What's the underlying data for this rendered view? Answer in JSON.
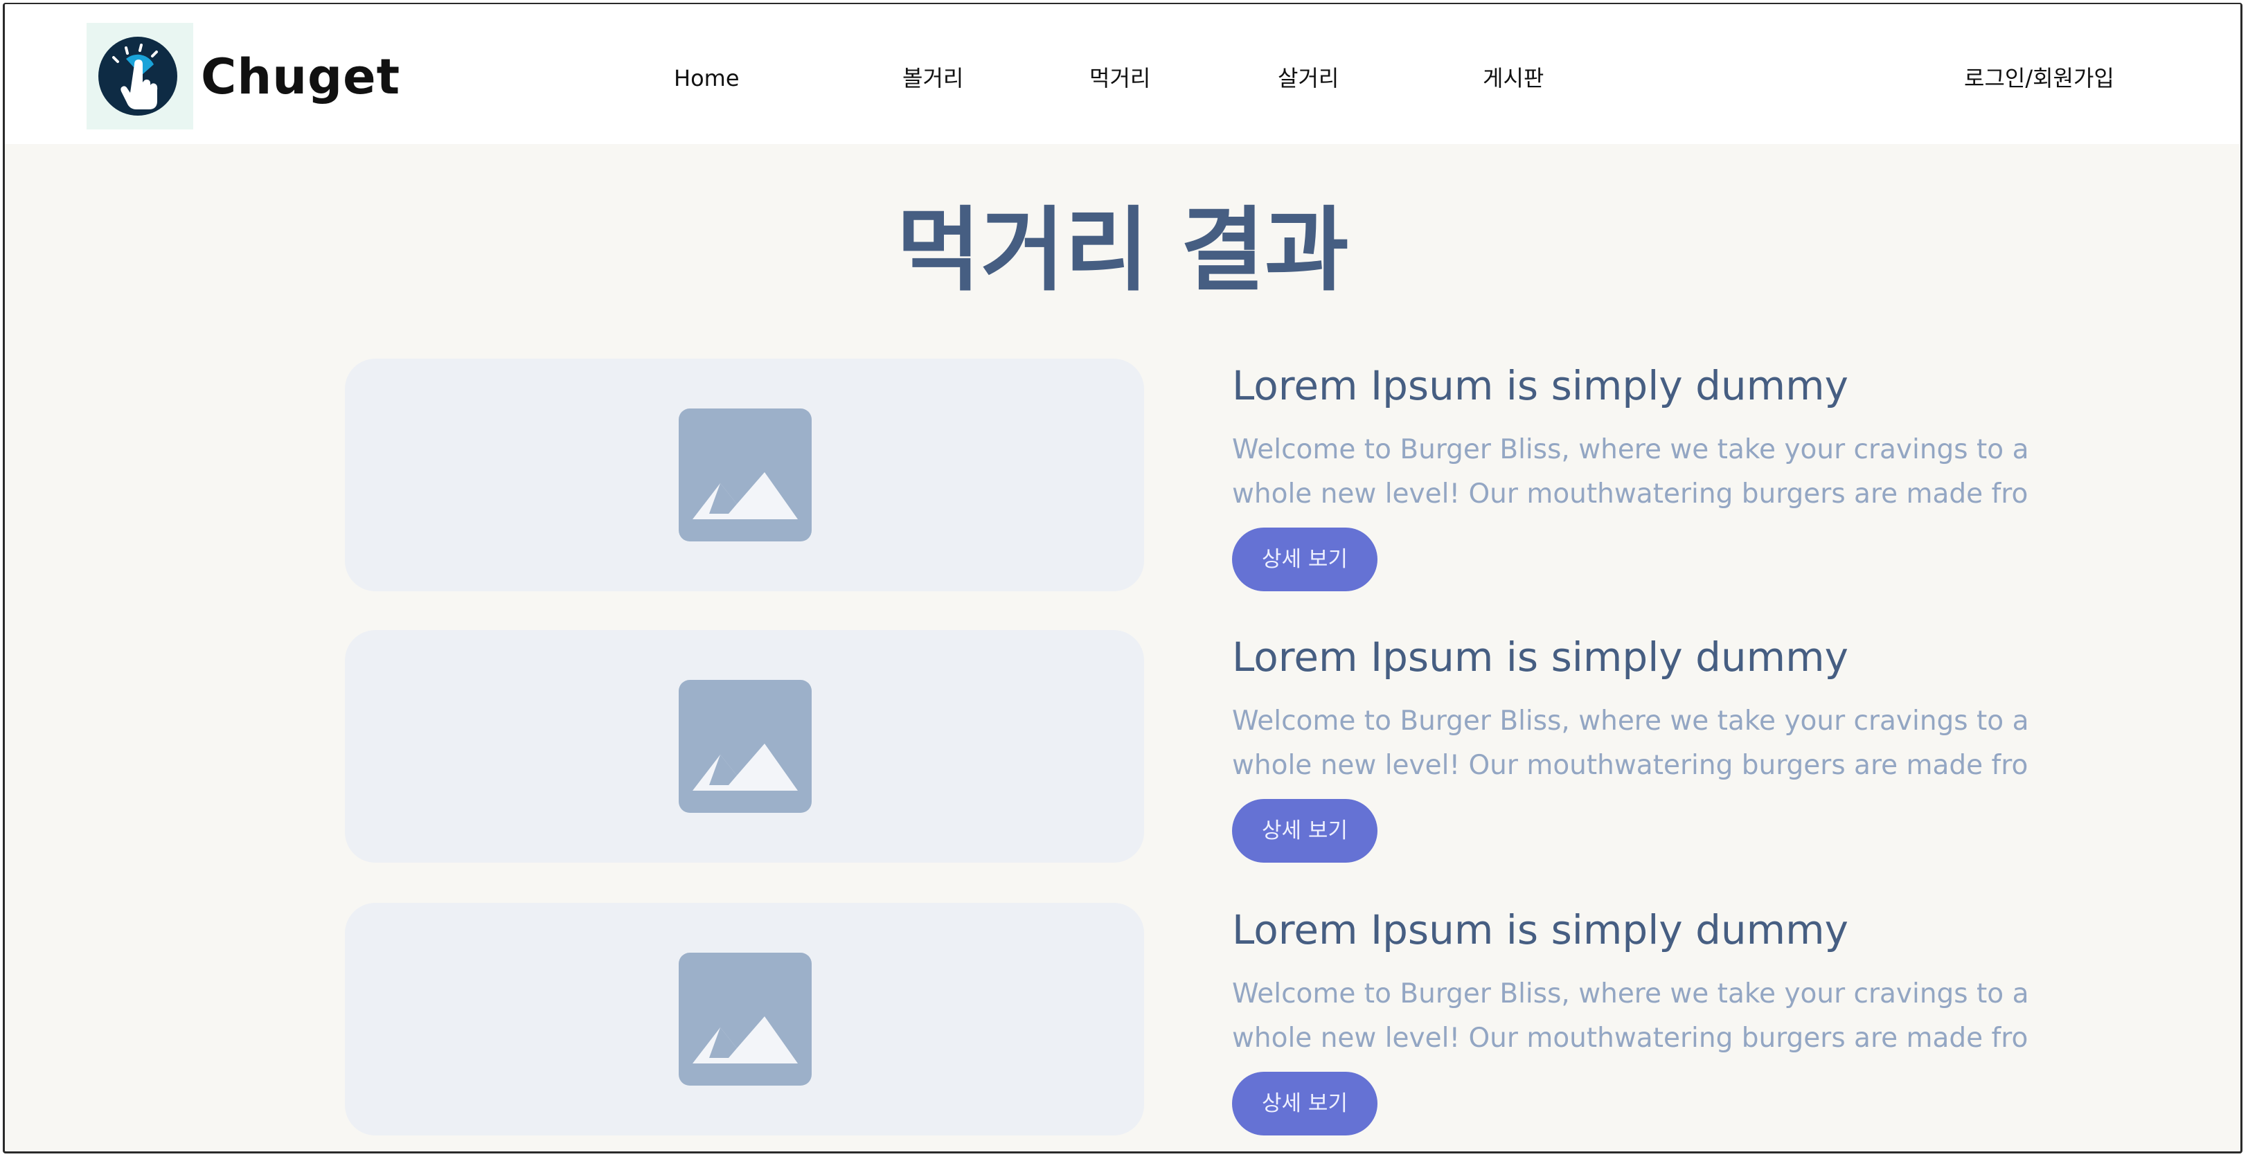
{
  "brand": {
    "name": "Chuget"
  },
  "nav": {
    "items": [
      {
        "label": "Home"
      },
      {
        "label": "볼거리"
      },
      {
        "label": "먹거리"
      },
      {
        "label": "살거리"
      },
      {
        "label": "게시판"
      }
    ],
    "login": "로그인/회원가입"
  },
  "main": {
    "title": "먹거리 결과",
    "cards": [
      {
        "title": "Lorem Ipsum is simply dummy",
        "desc_line1": "Welcome to Burger Bliss, where we take your cravings to a",
        "desc_line2": "whole new level! Our mouthwatering burgers are made fro",
        "button": "상세 보기"
      },
      {
        "title": "Lorem Ipsum is simply dummy",
        "desc_line1": "Welcome to Burger Bliss, where we take your cravings to a",
        "desc_line2": "whole new level! Our mouthwatering burgers are made fro",
        "button": "상세 보기"
      },
      {
        "title": "Lorem Ipsum is simply dummy",
        "desc_line1": "Welcome to Burger Bliss, where we take your cravings to a",
        "desc_line2": "whole new level! Our mouthwatering burgers are made fro",
        "button": "상세 보기"
      }
    ]
  },
  "colors": {
    "page_bg": "#f8f7f3",
    "title": "#465e82",
    "desc": "#93a6c3",
    "button": "#6572d4",
    "image_bg": "#edf0f5",
    "image_icon": "#9cb0c9",
    "logo_dark": "#0e2b44",
    "logo_accent": "#1aa3d9"
  },
  "icons": {
    "logo": "pointing-hand-icon",
    "image_placeholder": "image-placeholder-icon"
  }
}
